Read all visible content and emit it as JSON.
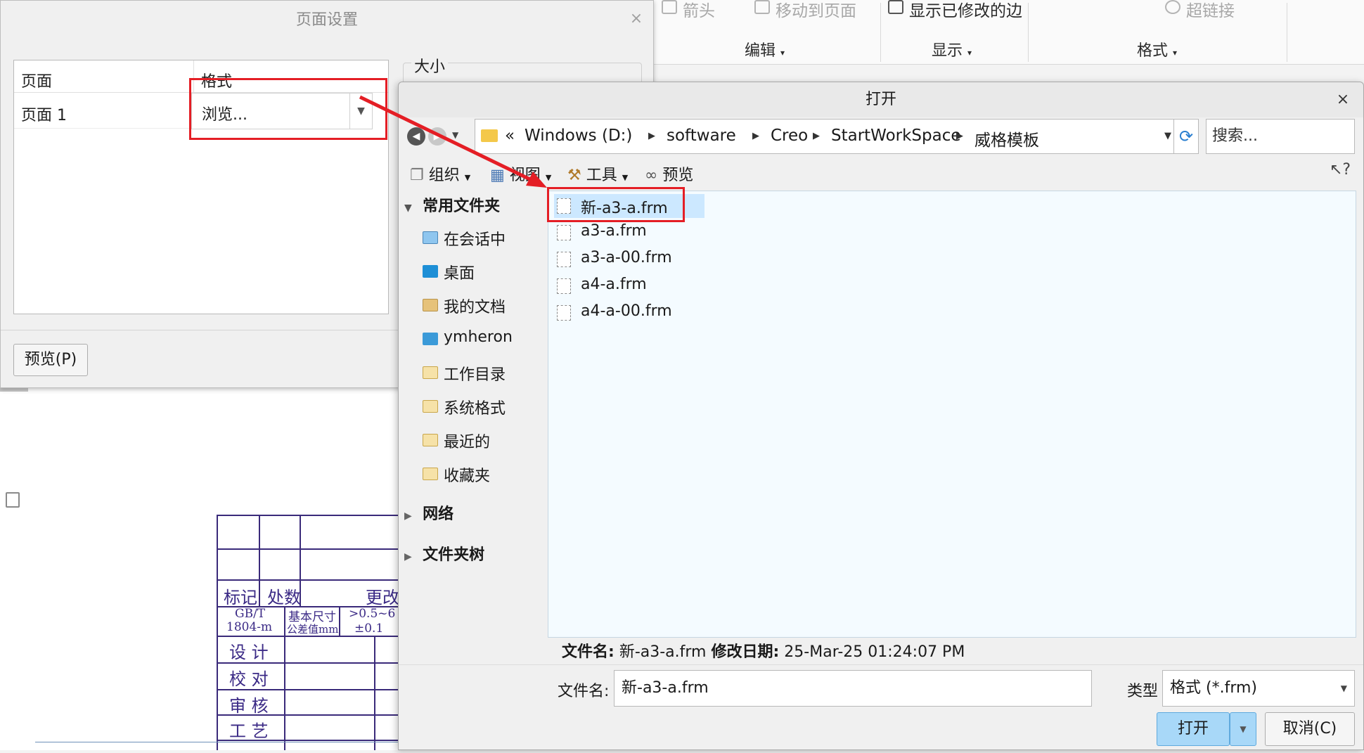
{
  "ribbon": {
    "items": [
      {
        "label": "箭头",
        "icon": "arrow-icon",
        "active": false
      },
      {
        "label": "移动到页面",
        "icon": "move-to-page-icon",
        "active": false
      },
      {
        "label": "显示已修改的边",
        "icon": "modified-edges-icon",
        "active": true
      },
      {
        "label": "超链接",
        "icon": "hyperlink-icon",
        "active": false
      }
    ],
    "groups": [
      "编辑",
      "显示",
      "格式"
    ]
  },
  "title_block": {
    "row_labels": [
      "标记",
      "处数",
      "更改"
    ],
    "standard_1": "GB/T",
    "standard_2": "1804-m",
    "col_a": "基本尺寸",
    "col_b": ">0.5~6",
    "col_c": "公差值mm",
    "col_d": "±0.1",
    "sign_rows": [
      "设  计",
      "校  对",
      "审  核",
      "工  艺"
    ]
  },
  "page_setup": {
    "title": "页面设置",
    "columns": [
      "页面",
      "格式"
    ],
    "row": {
      "page": "页面 1",
      "format": "浏览..."
    },
    "size_label": "大小",
    "preview_button": "预览(P)"
  },
  "open_dialog": {
    "title": "打开",
    "breadcrumb": [
      "Windows (D:)",
      "software",
      "Creo",
      "StartWorkSpace",
      "威格模板"
    ],
    "breadcrumb_prefix": "«",
    "search_placeholder": "搜索...",
    "toolbar": [
      "组织",
      "视图",
      "工具",
      "预览"
    ],
    "sidebar": {
      "common_header": "常用文件夹",
      "items": [
        "在会话中",
        "桌面",
        "我的文档",
        "ymheron",
        "工作目录",
        "系统格式",
        "最近的",
        "收藏夹"
      ],
      "network": "网络",
      "folder_tree": "文件夹树"
    },
    "files": [
      "新-a3-a.frm",
      "a3-a.frm",
      "a3-a-00.frm",
      "a4-a.frm",
      "a4-a-00.frm"
    ],
    "selected_file": "新-a3-a.frm",
    "info": {
      "name_label": "文件名:",
      "name_value": "新-a3-a.frm",
      "date_label": "修改日期:",
      "date_value": "25-Mar-25 01:24:07 PM"
    },
    "filename_label": "文件名:",
    "filename_value": "新-a3-a.frm",
    "type_label": "类型",
    "type_value": "格式 (*.frm)",
    "open_button": "打开",
    "cancel_button": "取消(C)"
  },
  "colors": {
    "annotation": "#e41e25",
    "selection": "#cce8ff",
    "primary_button": "#a8d8f8"
  }
}
